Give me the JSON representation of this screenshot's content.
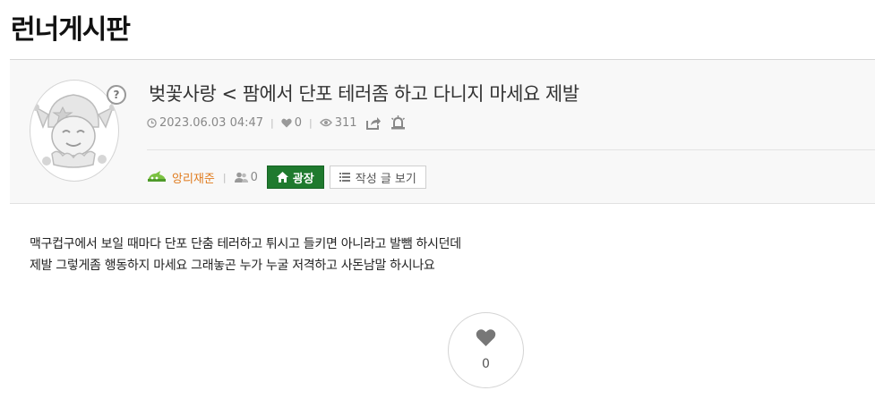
{
  "board": {
    "title": "런너게시판"
  },
  "post": {
    "title": "벚꽃사랑 < 팜에서 단포 테러좀 하고 다니지 마세요 제발",
    "datetime": "2023.06.03 04:47",
    "likes": "0",
    "views": "311",
    "body": [
      "맥구컵구에서 보일 때마다 단포 단춤 테러하고 튀시고 들키면 아니라고 발뺌 하시던데",
      "제발 그렇게좀 행동하지 마세요 그래놓곤 누가 누굴 저격하고 사돈남말 하시나요"
    ]
  },
  "author": {
    "name": "앙리재준",
    "friend_count": "0"
  },
  "buttons": {
    "square": "광장",
    "view_posts": "작성 글 보기",
    "help": "?"
  },
  "like_box": {
    "count": "0"
  },
  "icons": {
    "clock": "clock-icon",
    "heart": "heart-icon",
    "eye": "eye-icon",
    "share": "share-icon",
    "report": "siren-icon",
    "level": "level-badge-icon",
    "friends": "friends-icon",
    "home": "home-icon",
    "list": "list-icon"
  },
  "colors": {
    "author_name": "#e07b1e",
    "square_button": "#1f7a2e",
    "header_bg": "#f8f8f8"
  }
}
